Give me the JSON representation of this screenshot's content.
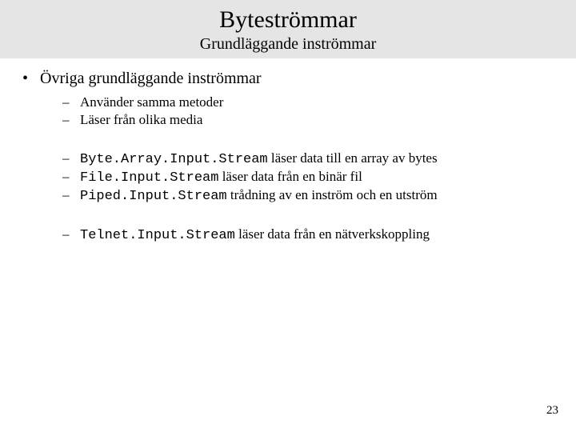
{
  "header": {
    "title": "Byteströmmar",
    "subtitle": "Grundläggande inströmmar"
  },
  "main_bullet": "Övriga grundläggande inströmmar",
  "group1": [
    "Använder samma metoder",
    "Läser från olika media"
  ],
  "group2": [
    {
      "code": "Byte.Array.Input.Stream",
      "text": " läser data till en array av bytes"
    },
    {
      "code": "File.Input.Stream",
      "text": " läser data från en binär fil"
    },
    {
      "code": "Piped.Input.Stream",
      "text": " trådning av en inström och en utström"
    }
  ],
  "group3": [
    {
      "code": "Telnet.Input.Stream",
      "text": " läser data från en nätverkskoppling"
    }
  ],
  "page_number": "23"
}
